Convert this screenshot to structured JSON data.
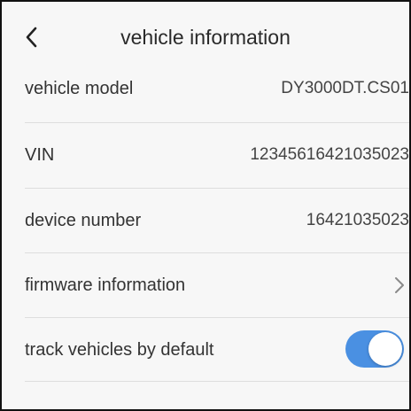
{
  "header": {
    "back_icon": "chevron-left-icon",
    "title": "vehicle information"
  },
  "rows": [
    {
      "label": "vehicle model",
      "value": "DY3000DT.CS01"
    },
    {
      "label": "VIN",
      "value": "12345616421035023"
    },
    {
      "label": "device number",
      "value": "16421035023"
    },
    {
      "label": "firmware information",
      "icon": "chevron-right-icon"
    },
    {
      "label": "track vehicles by default",
      "toggle_on": true
    }
  ],
  "colors": {
    "toggle_on": "#4a90e2",
    "background": "#f7f7f7",
    "divider": "#dedede"
  }
}
